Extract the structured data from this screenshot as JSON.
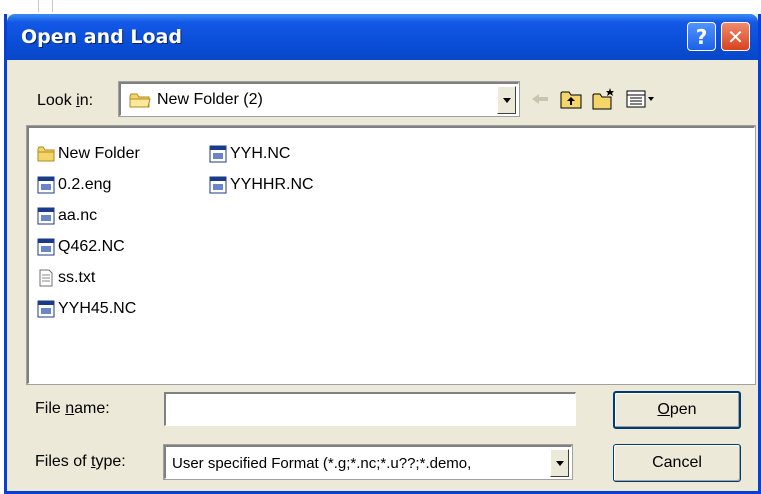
{
  "dialog": {
    "title": "Open and Load",
    "help_symbol": "?",
    "close_symbol": "✕"
  },
  "lookin": {
    "label_pre": "Look ",
    "label_ul": "i",
    "label_post": "n:",
    "value": "New Folder (2)"
  },
  "toolbar": {
    "icons": [
      "back-arrow-icon",
      "up-one-level-icon",
      "new-folder-icon",
      "view-menu-icon"
    ]
  },
  "files": [
    {
      "name": "New Folder",
      "icon": "folder-icon"
    },
    {
      "name": "0.2.eng",
      "icon": "nc-file-icon"
    },
    {
      "name": "aa.nc",
      "icon": "nc-file-icon"
    },
    {
      "name": "Q462.NC",
      "icon": "nc-file-icon"
    },
    {
      "name": "ss.txt",
      "icon": "text-file-icon"
    },
    {
      "name": "YYH45.NC",
      "icon": "nc-file-icon"
    },
    {
      "name": "YYH.NC",
      "icon": "nc-file-icon"
    },
    {
      "name": "YYHHR.NC",
      "icon": "nc-file-icon"
    }
  ],
  "filename": {
    "label_pre": "File ",
    "label_ul": "n",
    "label_post": "ame:",
    "value": "",
    "placeholder": ""
  },
  "filetype": {
    "label_pre": "Files of ",
    "label_ul": "t",
    "label_post": "ype:",
    "value": "User specified Format (*.g;*.nc;*.u??;*.demo,"
  },
  "buttons": {
    "open_ul": "O",
    "open_rest": "pen",
    "cancel": "Cancel"
  },
  "colors": {
    "titlebar": "#0a4fd8",
    "dialog_bg": "#ece9d8",
    "close_red": "#d8421e",
    "folder_yellow": "#f4d56a"
  }
}
